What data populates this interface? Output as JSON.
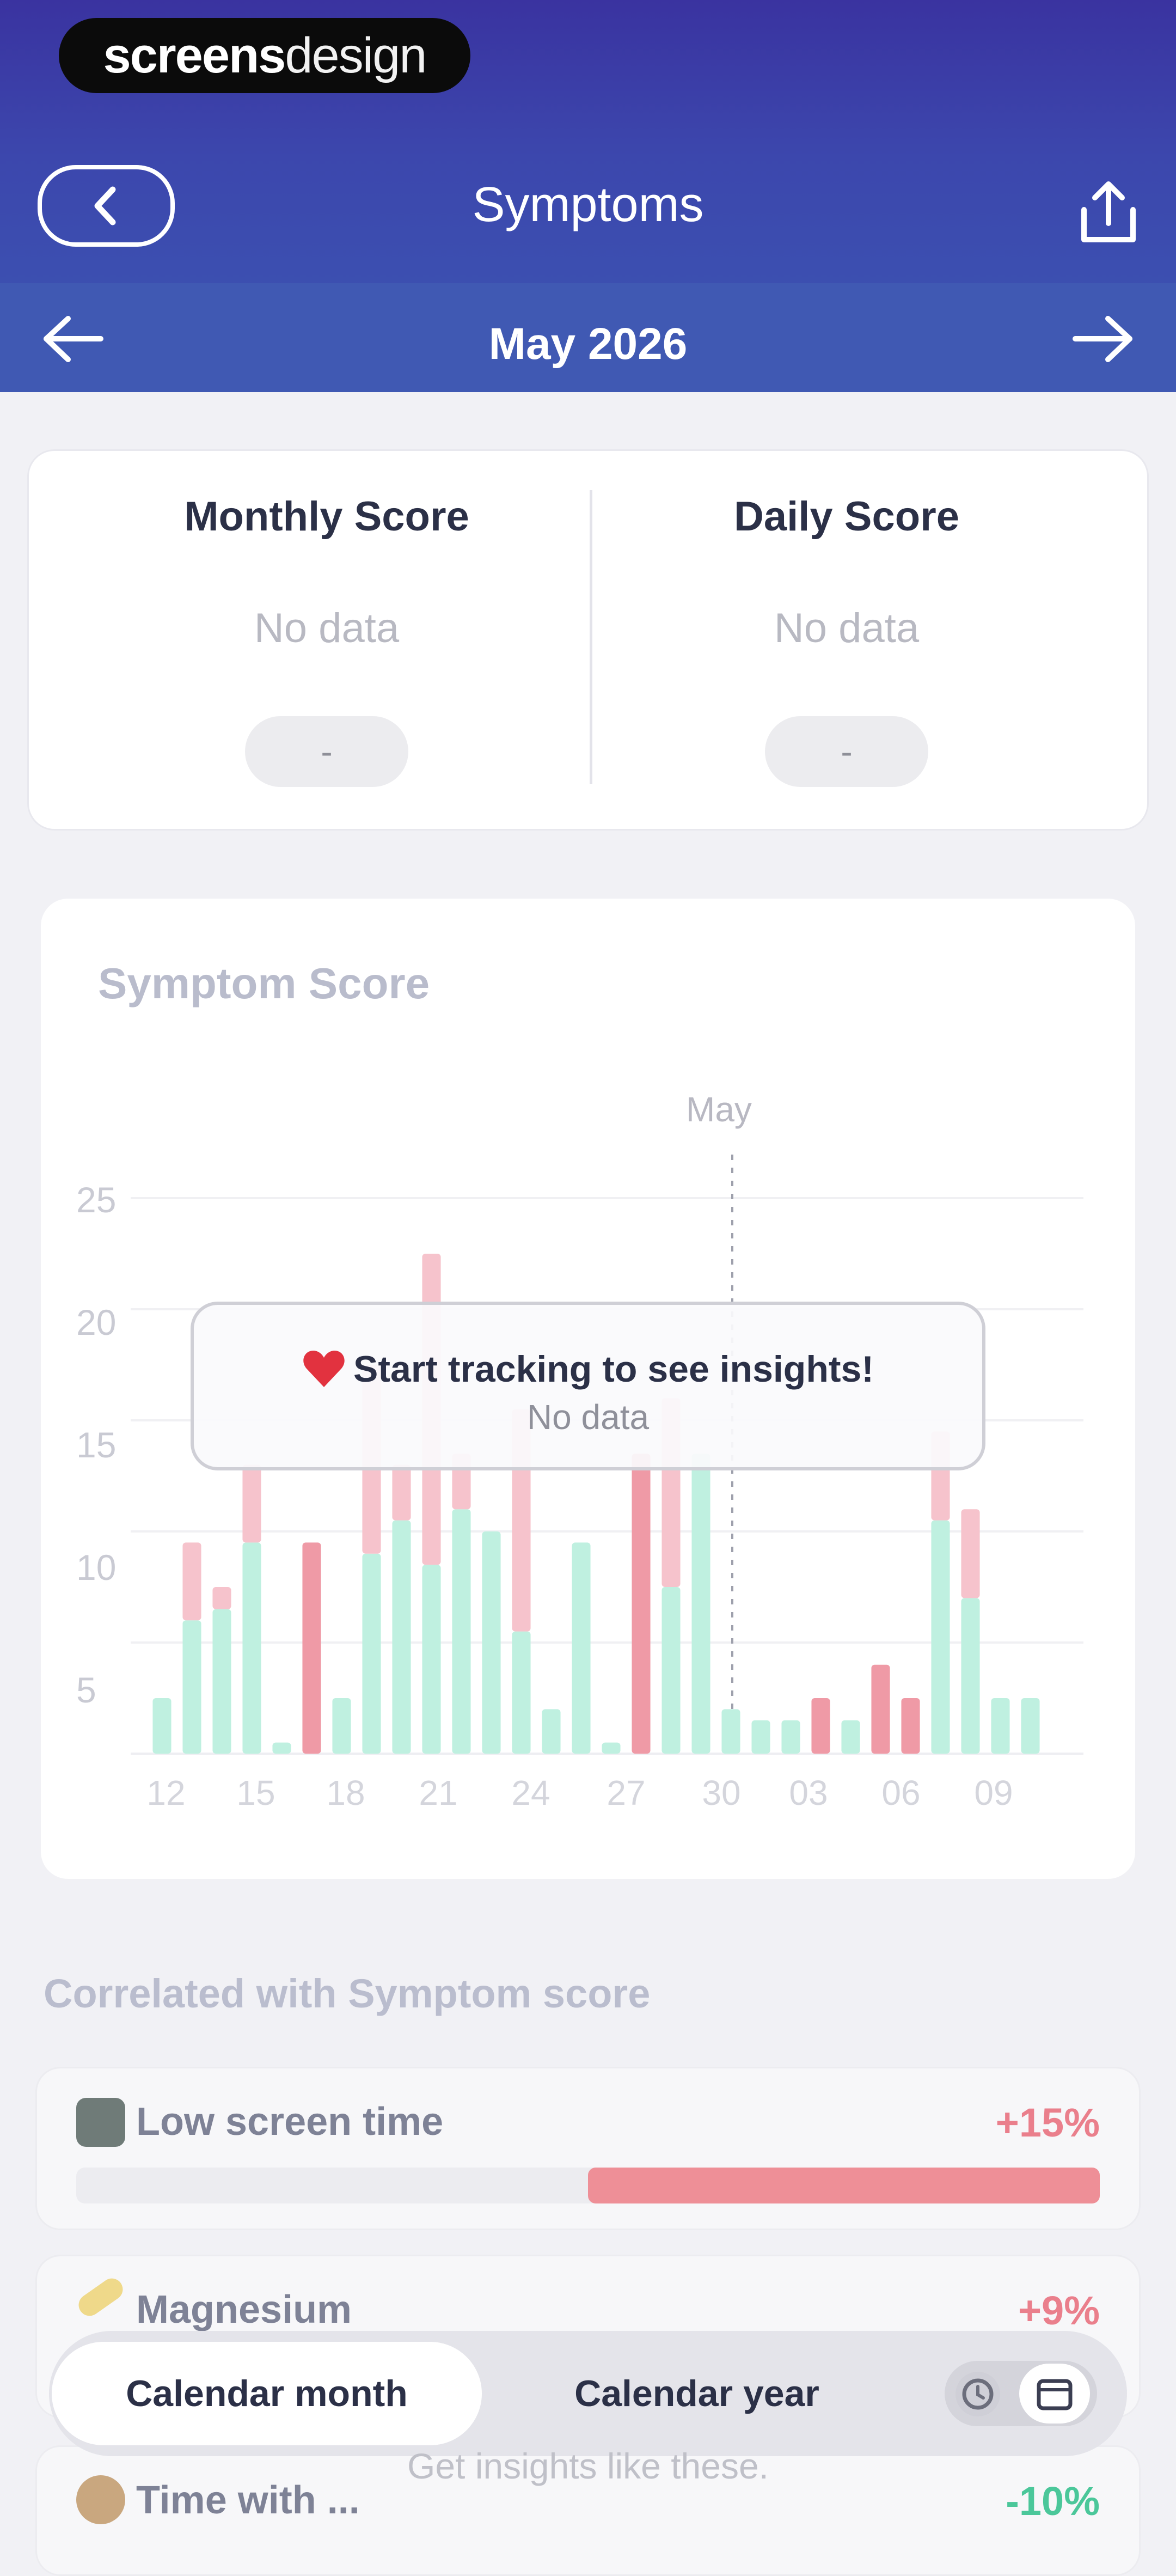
{
  "brand": {
    "bold": "screens",
    "light": "design"
  },
  "header": {
    "title": "Symptoms"
  },
  "month_nav": {
    "label": "May 2026"
  },
  "scores": {
    "monthly": {
      "title": "Monthly Score",
      "value": "No data",
      "pill": "-"
    },
    "daily": {
      "title": "Daily Score",
      "value": "No data",
      "pill": "-"
    }
  },
  "chart_data": {
    "type": "bar",
    "title": "Symptom Score",
    "month_marker": "May",
    "ylim": [
      0,
      25
    ],
    "yticks": [
      5,
      10,
      15,
      20,
      25
    ],
    "xticks": [
      "12",
      "15",
      "18",
      "21",
      "24",
      "27",
      "30",
      "03",
      "06",
      "09"
    ],
    "x": [
      "11",
      "12",
      "13",
      "14",
      "15",
      "16",
      "17",
      "18",
      "19",
      "20",
      "21",
      "22",
      "23",
      "24",
      "25",
      "26",
      "27",
      "28",
      "29",
      "30",
      "01",
      "02",
      "03",
      "04",
      "05",
      "06",
      "07",
      "08",
      "09",
      "10",
      "11"
    ],
    "series": [
      {
        "values": [
          2.5,
          6,
          6.5,
          9.5,
          0.5,
          0,
          2.5,
          9,
          10.5,
          8.5,
          11,
          10,
          5.5,
          2,
          9.5,
          0.5,
          0,
          7.5,
          13.5,
          2,
          1.5,
          1.5,
          0,
          1.5,
          0,
          0,
          10.5,
          7,
          2.5,
          2.5,
          0
        ]
      },
      {
        "values": [
          0,
          3.5,
          1,
          3.5,
          0,
          9.5,
          0,
          8.5,
          2.5,
          14,
          2.5,
          0,
          10,
          0,
          0,
          0,
          13.5,
          8.5,
          0,
          0,
          0,
          0,
          2.5,
          0,
          4,
          2.5,
          4,
          4,
          0,
          0,
          0
        ]
      }
    ],
    "colors": {
      "base": "#bff0e0",
      "top": "#f6c3cc",
      "top_strong": "#ef9aa6"
    },
    "overlay": {
      "title": "Start tracking to see insights!",
      "subtitle": "No data"
    }
  },
  "correlations": {
    "heading": "Correlated with Symptom score",
    "items": [
      {
        "label": "Low screen time",
        "value": "+15%",
        "bar_fraction": 0.5,
        "color": "#e8808c"
      },
      {
        "label": "Magnesium",
        "value": "+9%",
        "color": "#e8808c"
      },
      {
        "label": "Time with ...",
        "value": "-10%",
        "color": "#4bc79a"
      }
    ]
  },
  "tabs": {
    "active": "Calendar month",
    "inactive": "Calendar year"
  },
  "hint": "Get insights like these."
}
